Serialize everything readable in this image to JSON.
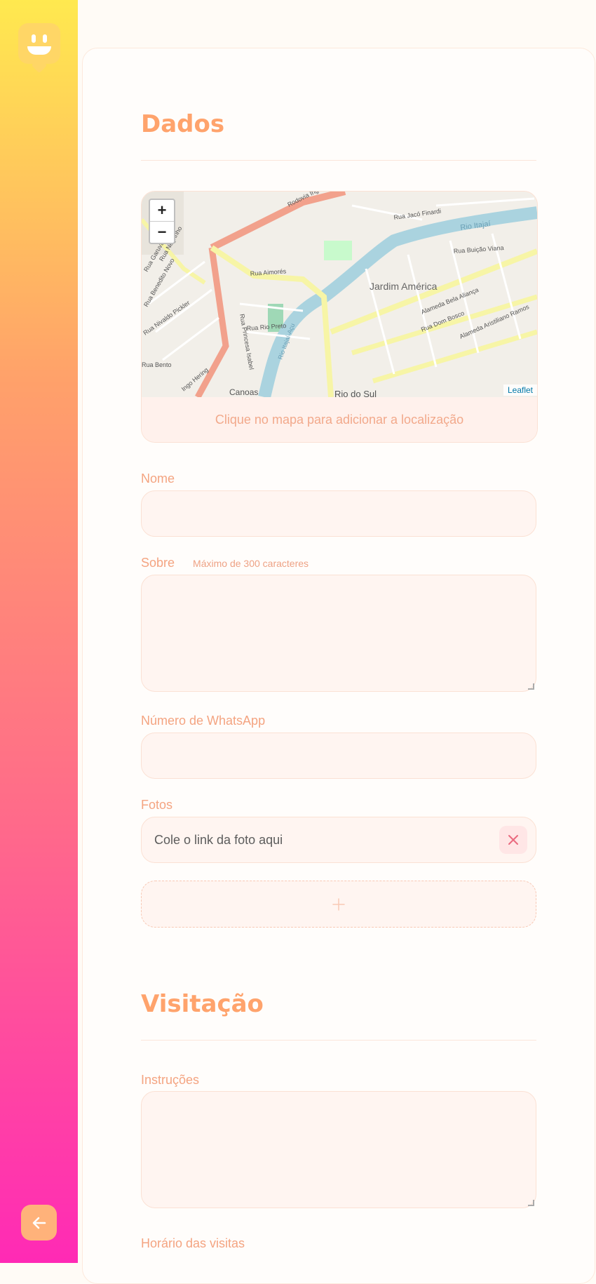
{
  "sections": {
    "dados": "Dados",
    "visitacao": "Visitação"
  },
  "map": {
    "hint": "Clique no mapa para adicionar a localização",
    "zoom_in": "+",
    "zoom_out": "−",
    "attribution": "Leaflet",
    "labels": [
      "Rodovia Ingo Hering",
      "Rua Jacó Finardi",
      "Rio Itajaí",
      "Rua Buição Viana",
      "Rua Aimorés",
      "Jardim América",
      "Alameda Bela Aliança",
      "Rua Dom Bosco",
      "Alameda Aristiliano Ramos",
      "Rua Rio Preto",
      "Rua Princesa Isabel",
      "Ingo Hering",
      "Rio Itajaí-Açu",
      "Canoas",
      "Rio do Sul",
      "Rua Nivaldo Pickler",
      "Rua Benedito Novo",
      "Rua Garuva",
      "Rua Negrinho",
      "Rua Bento"
    ],
    "colors": {
      "road_major": "#f2a18c",
      "road_secondary": "#f7f5a6",
      "river": "#aad3df",
      "land": "#f2efe9",
      "park": "#c8facc"
    }
  },
  "form": {
    "nome_label": "Nome",
    "sobre_label": "Sobre",
    "sobre_hint": "Máximo de 300 caracteres",
    "whatsapp_label": "Número de WhatsApp",
    "fotos_label": "Fotos",
    "foto_placeholder": "Cole o link da foto aqui",
    "instrucoes_label": "Instruções",
    "horario_label": "Horário das visitas"
  },
  "icons": {
    "logo": "smiley-pin-icon",
    "back": "arrow-left-icon",
    "remove": "close-icon",
    "add": "plus-icon"
  },
  "colors": {
    "accent": "#ffa36c",
    "label": "#f4a481",
    "field_bg": "#fff5f1",
    "remove": "#ea6a7f"
  }
}
